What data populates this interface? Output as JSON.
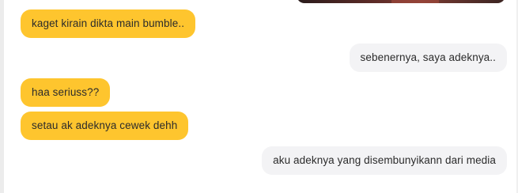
{
  "conversation": {
    "messages": [
      {
        "direction": "received",
        "text": "kaget kirain dikta main bumble.."
      },
      {
        "direction": "sent",
        "text": "sebenernya, saya adeknya.."
      },
      {
        "direction": "received",
        "text": "haa seriuss??"
      },
      {
        "direction": "received",
        "text": "setau ak adeknya cewek dehh"
      },
      {
        "direction": "sent",
        "text": "aku adeknya yang disembunyikann dari media"
      }
    ]
  },
  "colors": {
    "received_bubble": "#fec52e",
    "sent_bubble": "#f3f3f5",
    "text": "#2b2b2b",
    "background": "#ffffff"
  }
}
